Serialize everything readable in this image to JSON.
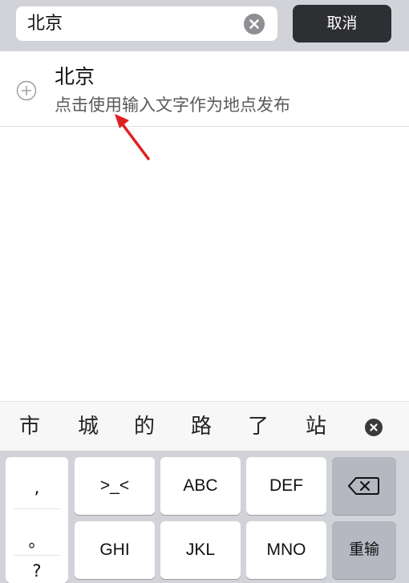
{
  "search": {
    "query": "北京",
    "cancel_label": "取消"
  },
  "result": {
    "title": "北京",
    "subtitle": "点击使用输入文字作为地点发布"
  },
  "candidates": [
    "市",
    "城",
    "的",
    "路",
    "了",
    "站"
  ],
  "keyboard": {
    "punct": [
      ",",
      "。",
      "?"
    ],
    "row1": [
      ">_<",
      "ABC",
      "DEF"
    ],
    "row2": [
      "GHI",
      "JKL",
      "MNO"
    ],
    "enter_label": "重输"
  },
  "colors": {
    "annotation_arrow": "#e02020",
    "cancel_bg": "#2e2f33"
  }
}
